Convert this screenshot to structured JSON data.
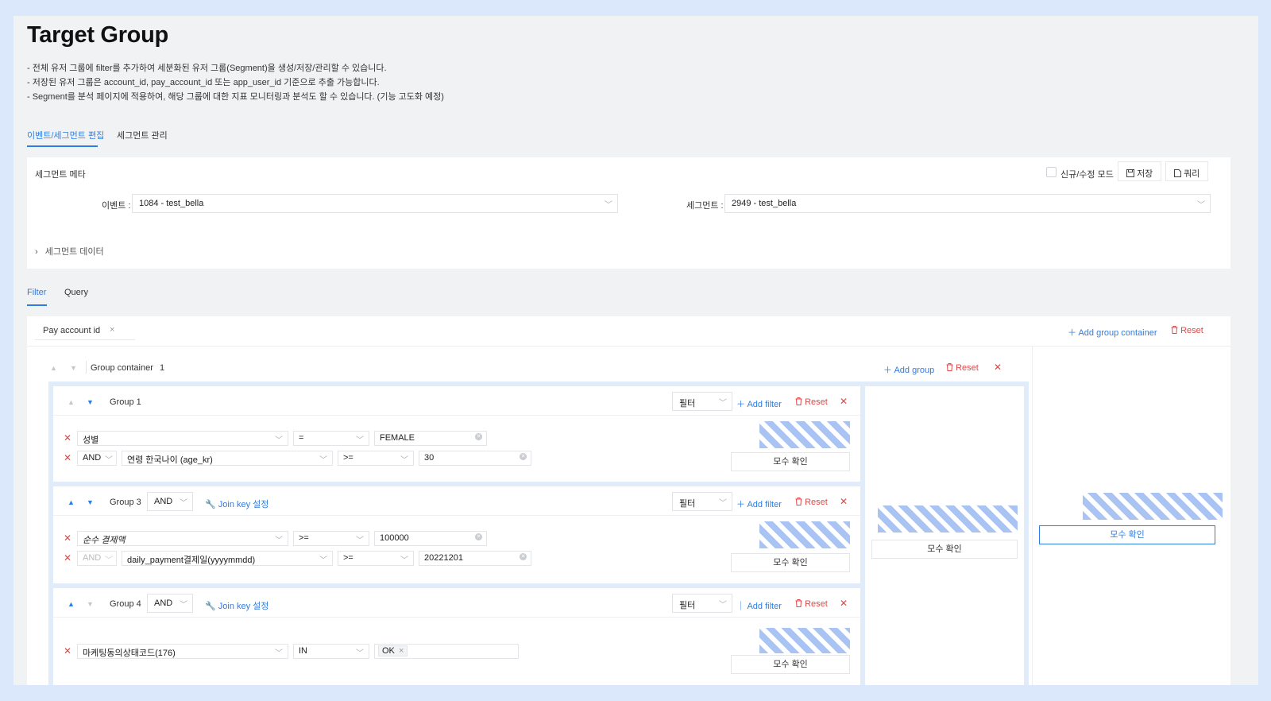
{
  "page": {
    "title": "Target Group",
    "descriptions": [
      "- 전체 유저 그룹에 filter를 추가하여 세분화된 유저 그룹(Segment)을 생성/저장/관리할 수 있습니다.",
      "- 저장된 유저 그룹은 account_id, pay_account_id 또는 app_user_id 기준으로 추출 가능합니다.",
      "- Segment를 분석 페이지에 적용하여, 해당 그룹에 대한 지표 모니터링과 분석도 할 수 있습니다. (기능 고도화 예정)"
    ]
  },
  "top_tabs": [
    {
      "label": "이벤트/세그먼트 편집",
      "active": true
    },
    {
      "label": "세그먼트 관리",
      "active": false
    }
  ],
  "meta_panel": {
    "title": "세그먼트 메타",
    "new_edit_mode_label": "신규/수정 모드",
    "save_label": "저장",
    "query_label": "쿼리",
    "event_label": "이벤트 :",
    "event_value": "1084 - test_bella",
    "segment_label": "세그먼트 :",
    "segment_value": "2949 - test_bella",
    "segment_data_label": "세그먼트 데이터"
  },
  "sub_tabs": [
    {
      "label": "Filter",
      "active": true
    },
    {
      "label": "Query",
      "active": false
    }
  ],
  "filter_panel": {
    "tag_label": "Pay account id",
    "add_group_container": "Add group container",
    "reset": "Reset",
    "container": {
      "title": "Group container",
      "index": "1",
      "add_group": "Add group",
      "reset": "Reset"
    },
    "groups": [
      {
        "title": "Group 1",
        "type_select": "필터",
        "add_filter": "Add filter",
        "reset": "Reset",
        "count_button": "모수 확인",
        "filters": [
          {
            "field": "성별",
            "op": "=",
            "value": "FEMALE"
          },
          {
            "conj": "AND",
            "field": "연령 한국나이 (age_kr)",
            "op": ">=",
            "value": "30"
          }
        ]
      },
      {
        "title": "Group 3",
        "conj": "AND",
        "join_key": "Join key 설정",
        "type_select": "필터",
        "add_filter": "Add filter",
        "reset": "Reset",
        "count_button": "모수 확인",
        "filters": [
          {
            "field": "순수 결제액",
            "op": ">=",
            "value": "100000"
          },
          {
            "conj": "AND",
            "field": "daily_payment결제일(yyyymmdd)",
            "op": ">=",
            "value": "20221201"
          }
        ]
      },
      {
        "title": "Group 4",
        "conj": "AND",
        "join_key": "Join key 설정",
        "type_select": "필터",
        "add_filter": "Add filter",
        "reset": "Reset",
        "count_button": "모수 확인",
        "filters": [
          {
            "field": "마케팅동의상태코드(176)",
            "op": "IN",
            "value": "OK"
          }
        ]
      }
    ],
    "container_count_button": "모수 확인",
    "total_count_button": "모수 확인"
  },
  "colors": {
    "accent": "#2f7de1",
    "danger": "#e04848",
    "frame_bg": "#dbe8fb",
    "page_bg": "#f1f2f4",
    "hatch": "#a9c4f2"
  }
}
